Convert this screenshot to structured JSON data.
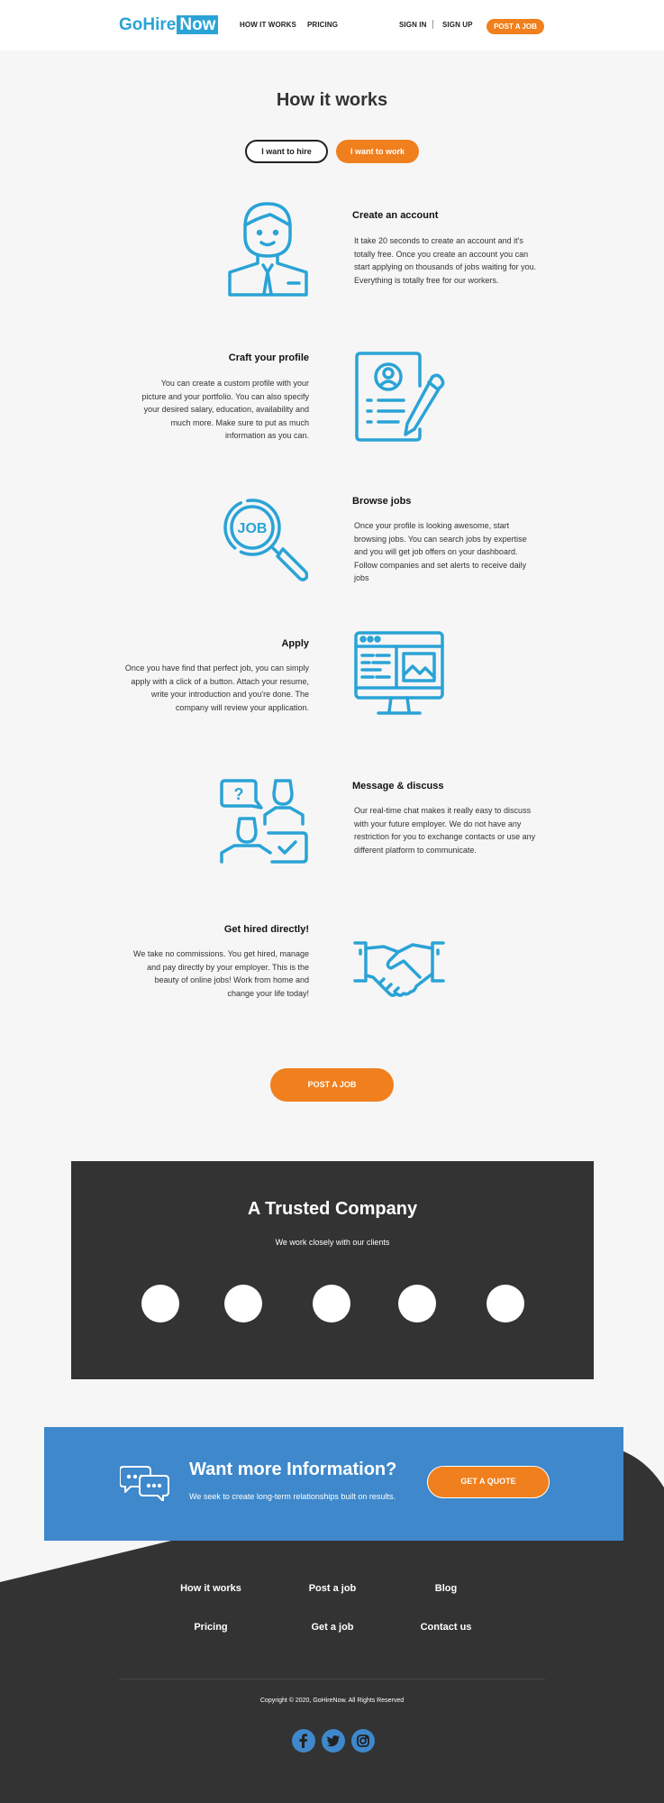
{
  "header": {
    "logo": {
      "go": "Go",
      "hire": "Hire",
      "now": "Now"
    },
    "nav": [
      "HOW IT WORKS",
      "PRICING"
    ],
    "sign_in": "SIGN IN",
    "sign_up": "SIGN UP",
    "post_job": "POST A JOB"
  },
  "how": {
    "title": "How it works",
    "toggle_hire": "I want to hire",
    "toggle_work": "I want to work",
    "steps": [
      {
        "title": "Create an account",
        "text": "It take 20 seconds to create an account and it's totally free. Once you create an account you can start applying on thousands of jobs waiting for you. Everything is totally free for our workers.",
        "icon": "worker-icon"
      },
      {
        "title": "Craft your profile",
        "text": "You can create a custom profile with your picture and your portfolio. You can also specify your desired salary, education, availability and much more. Make sure to put as much information as you can.",
        "icon": "profile-document-icon"
      },
      {
        "title": "Browse jobs",
        "text": "Once your profile is looking awesome, start browsing jobs. You can search jobs by expertise and you will get job offers on your dashboard. Follow companies and set alerts to receive daily jobs",
        "icon": "job-search-icon"
      },
      {
        "title": "Apply",
        "text": "Once you have find that perfect job, you can simply apply with a click of a button. Attach your resume, write your introduction and you're done. The company will review your application.",
        "icon": "monitor-icon"
      },
      {
        "title": "Message & discuss",
        "text": "Our real-time chat makes it really easy to discuss with your future employer. We do not have any restriction for you to exchange contacts or use any different platform to communicate.",
        "icon": "chat-people-icon"
      },
      {
        "title": "Get hired directly!",
        "text": "We take no commissions. You get hired, manage and pay directly by your employer. This is the beauty of online jobs! Work from home and change your life today!",
        "icon": "handshake-icon"
      }
    ],
    "cta": "POST A JOB"
  },
  "trusted": {
    "title": "A Trusted Company",
    "subtitle": "We work closely with our clients"
  },
  "info": {
    "title": "Want more Information?",
    "subtitle": "We seek to create long-term relationships built on results.",
    "button": "GET A QUOTE"
  },
  "footer": {
    "links": [
      "How it works",
      "Post a job",
      "Blog",
      "Pricing",
      "Get a job",
      "Contact us"
    ],
    "copyright": "Copyright © 2020, GoHireNow. All Rights Reserved"
  },
  "colors": {
    "accent": "#f07f1d",
    "brand": "#2aa3d6",
    "info": "#3e88cb",
    "dark": "#333333"
  }
}
